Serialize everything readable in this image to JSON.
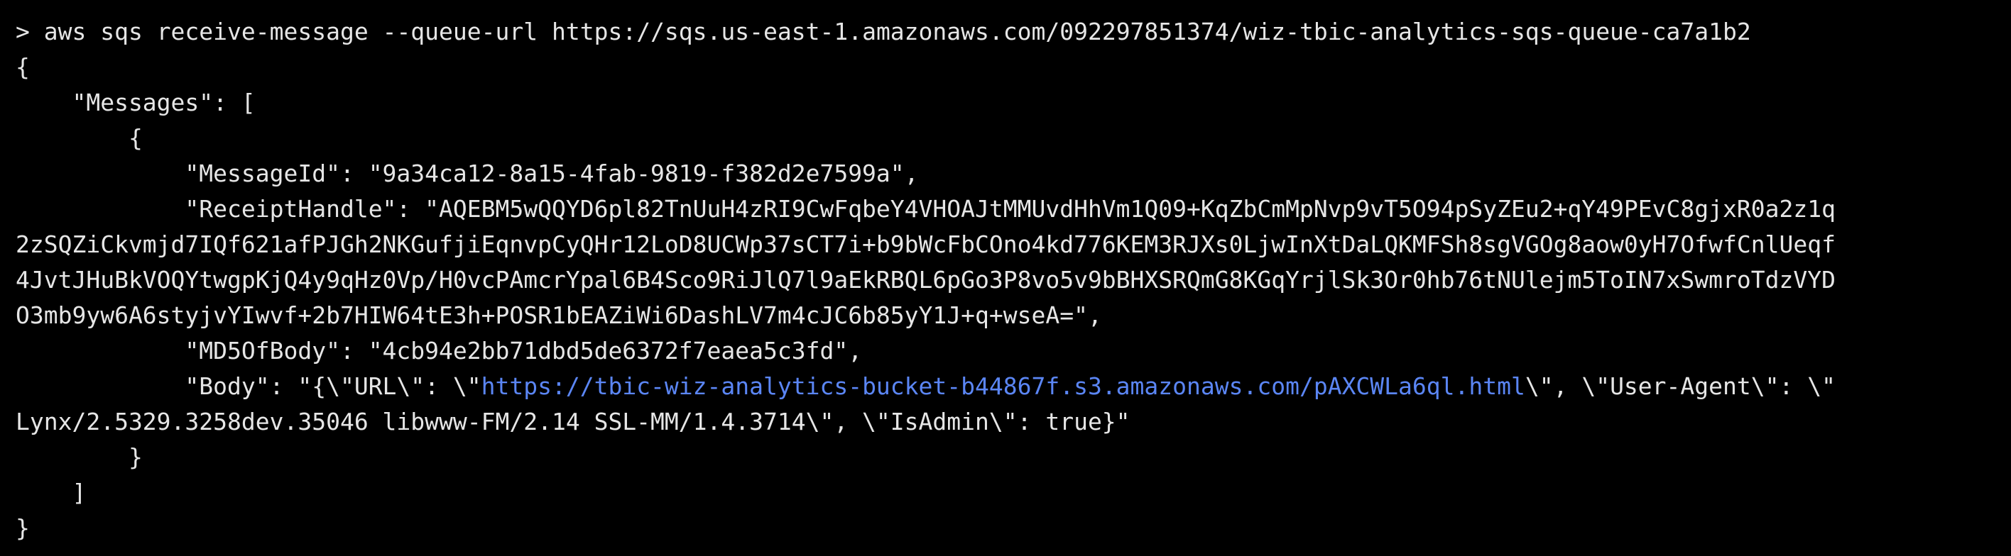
{
  "terminal": {
    "prompt": "> ",
    "command": "aws sqs receive-message --queue-url https://sqs.us-east-1.amazonaws.com/092297851374/wiz-tbic-analytics-sqs-queue-ca7a1b2",
    "lines": {
      "open_brace": "{",
      "messages_key": "    \"Messages\": [",
      "item_open": "        {",
      "message_id": "            \"MessageId\": \"9a34ca12-8a15-4fab-9819-f382d2e7599a\",",
      "receipt_handle_1": "            \"ReceiptHandle\": \"AQEBM5wQQYD6pl82TnUuH4zRI9CwFqbeY4VHOAJtMMUvdHhVm1Q09+KqZbCmMpNvp9vT5O94pSyZEu2+qY49PEvC8gjxR0a2z1q",
      "receipt_handle_2": "2zSQZiCkvmjd7IQf621afPJGh2NKGufjiEqnvpCyQHr12LoD8UCWp37sCT7i+b9bWcFbCOno4kd776KEM3RJXs0LjwInXtDaLQKMFSh8sgVGOg8aow0yH7OfwfCnlUeqf",
      "receipt_handle_3": "4JvtJHuBkVOQYtwgpKjQ4y9qHz0Vp/H0vcPAmcrYpal6B4Sco9RiJlQ7l9aEkRBQL6pGo3P8vo5v9bBHXSRQmG8KGqYrjlSk3Or0hb76tNUlejm5ToIN7xSwmroTdzVYD",
      "receipt_handle_4": "O3mb9yw6A6styjvYIwvf+2b7HIW64tE3h+POSR1bEAZiWi6DashLV7m4cJC6b85yY1J+q+wseA=\",",
      "md5_of_body": "            \"MD5OfBody\": \"4cb94e2bb71dbd5de6372f7eaea5c3fd\",",
      "body_prefix": "            \"Body\": \"{\\\"URL\\\": \\\"",
      "body_url": "https://tbic-wiz-analytics-bucket-b44867f.s3.amazonaws.com/pAXCWLa6ql.html",
      "body_suffix": "\\\", \\\"User-Agent\\\": \\\"",
      "body_cont": "Lynx/2.5329.3258dev.35046 libwww-FM/2.14 SSL-MM/1.4.3714\\\", \\\"IsAdmin\\\": true}\"",
      "item_close": "        }",
      "messages_close": "    ]",
      "close_brace": "}"
    }
  },
  "colors": {
    "background": "#000000",
    "text": "#e6e6e6",
    "link": "#5b86f5"
  }
}
